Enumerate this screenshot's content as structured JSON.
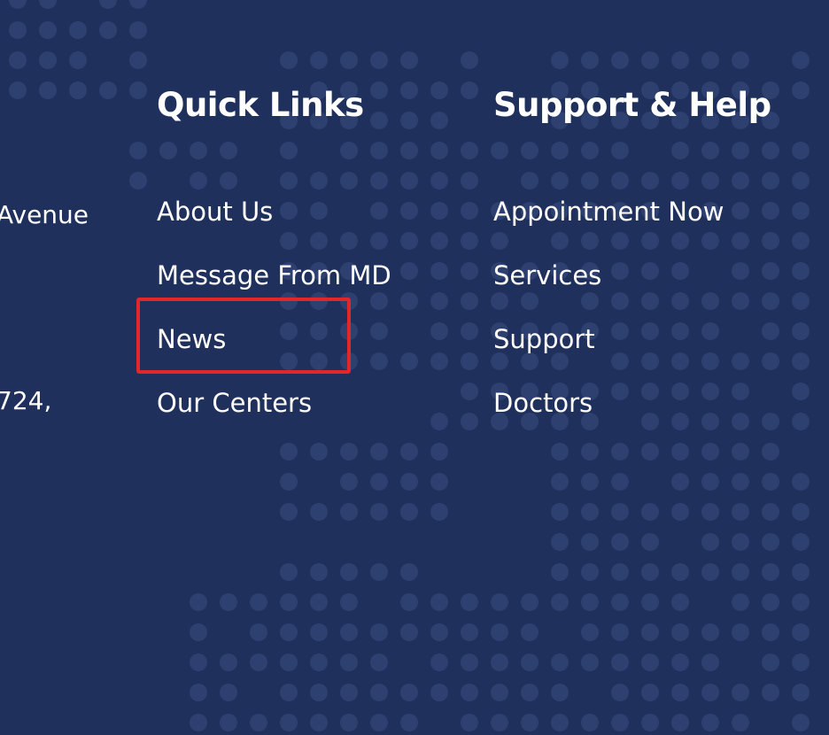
{
  "theme": {
    "background": "#1f305c",
    "dot_color": "#2d4070",
    "text": "#ffffff",
    "highlight": "#e4252a"
  },
  "address": {
    "line1": "Avenue",
    "line2": "724,"
  },
  "quick_links": {
    "heading": "Quick Links",
    "items": [
      {
        "label": "About Us"
      },
      {
        "label": "Message From MD"
      },
      {
        "label": "News"
      },
      {
        "label": "Our Centers"
      }
    ]
  },
  "support": {
    "heading": "Support & Help",
    "items": [
      {
        "label": "Appointment Now"
      },
      {
        "label": "Services"
      },
      {
        "label": "Support"
      },
      {
        "label": "Doctors"
      }
    ]
  }
}
